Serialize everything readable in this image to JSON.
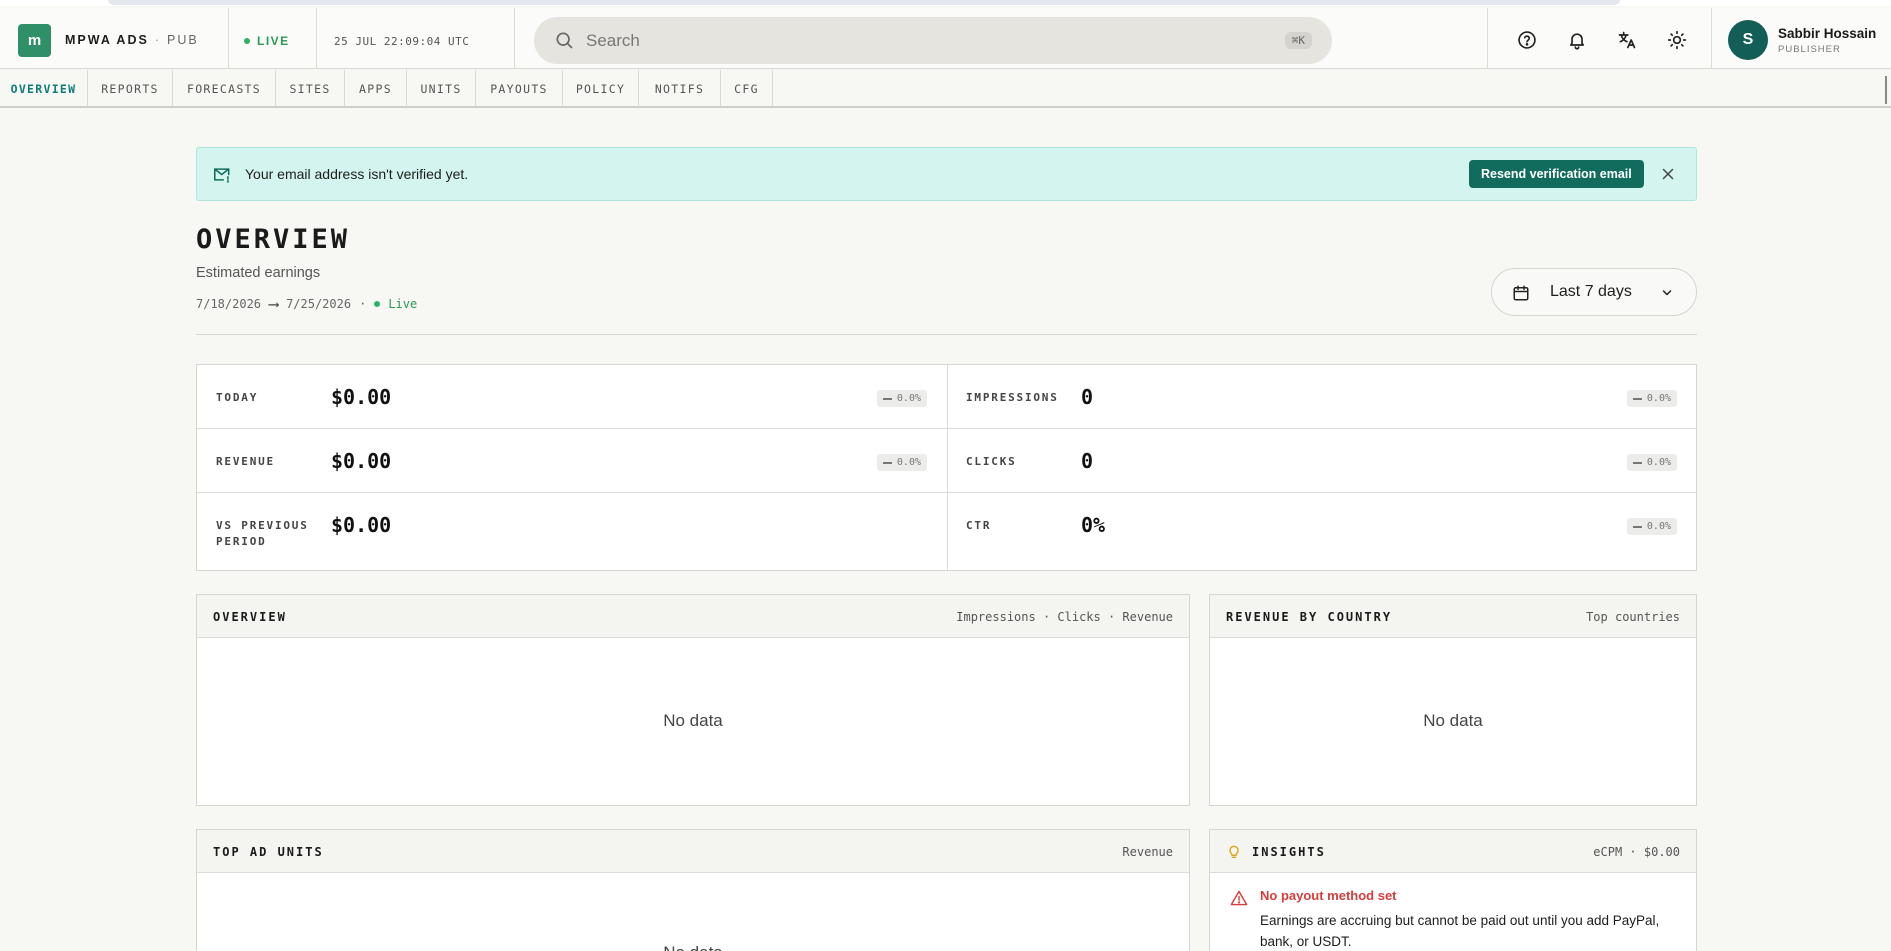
{
  "header": {
    "logo_letter": "m",
    "brand": "MPWA ADS",
    "brand_sep": "·",
    "brand_role": "PUB",
    "live_label": "LIVE",
    "clock": "25 JUL 22:09:04 UTC",
    "search_placeholder": "Search",
    "search_shortcut": "⌘K",
    "icons": [
      "help-icon",
      "bell-icon",
      "translate-icon",
      "sun-icon"
    ],
    "user": {
      "initial": "S",
      "name": "Sabbir Hossain",
      "role": "PUBLISHER"
    }
  },
  "nav": {
    "tabs": [
      "OVERVIEW",
      "REPORTS",
      "FORECASTS",
      "SITES",
      "APPS",
      "UNITS",
      "PAYOUTS",
      "POLICY",
      "NOTIFS",
      "CFG"
    ],
    "active": "OVERVIEW"
  },
  "alert": {
    "message": "Your email address isn't verified yet.",
    "action": "Resend verification email"
  },
  "page": {
    "title": "OVERVIEW",
    "subtitle": "Estimated earnings",
    "range_start": "7/18/2026",
    "range_arrow": "⟶",
    "range_end": "7/25/2026",
    "range_sep": "·",
    "status": "Live",
    "date_picker": "Last 7 days"
  },
  "stats": {
    "left": [
      {
        "label": "TODAY",
        "value": "$0.00",
        "change": "0.0%"
      },
      {
        "label": "REVENUE",
        "value": "$0.00",
        "change": "0.0%"
      },
      {
        "label": "VS PREVIOUS PERIOD",
        "value": "$0.00",
        "change": ""
      }
    ],
    "right": [
      {
        "label": "IMPRESSIONS",
        "value": "0",
        "change": "0.0%"
      },
      {
        "label": "CLICKS",
        "value": "0",
        "change": "0.0%"
      },
      {
        "label": "CTR",
        "value": "0%",
        "change": "0.0%"
      }
    ]
  },
  "panels": {
    "overview": {
      "title": "OVERVIEW",
      "meta": "Impressions · Clicks · Revenue",
      "empty": "No data"
    },
    "revenue_by_country": {
      "title": "REVENUE BY COUNTRY",
      "meta": "Top countries",
      "empty": "No data"
    },
    "top_ad_units": {
      "title": "TOP AD UNITS",
      "meta": "Revenue",
      "empty": "No data"
    },
    "insights": {
      "title": "INSIGHTS",
      "meta": "eCPM · $0.00",
      "item_title": "No payout method set",
      "item_text": "Earnings are accruing but cannot be paid out until you add PayPal, bank, or USDT."
    }
  },
  "colors": {
    "accent": "#0f7c7a",
    "brand": "#2f8f66",
    "live": "#2a9a55",
    "alert_bg": "#d4f5ef",
    "alert_button": "#126c5e",
    "warning": "#d63d3d"
  }
}
